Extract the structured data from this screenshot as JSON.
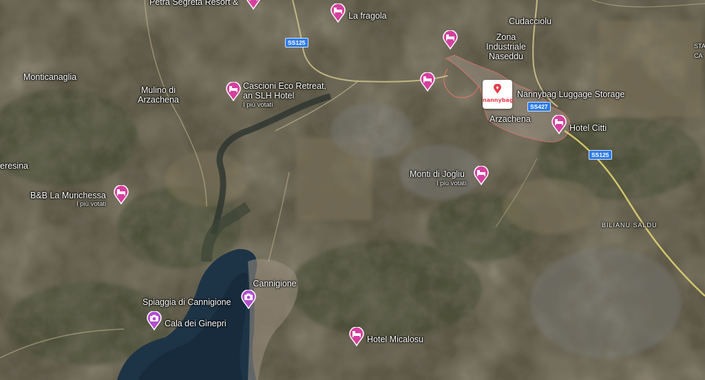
{
  "map": {
    "places": {
      "petra_segreta": "Petra Segreta Resort &",
      "la_fragola": "La fragola",
      "cudacciolu": "Cudacciolu",
      "zona_industriale": "Zona\nIndustriale\nNaseddu",
      "monticanaglia": "Monticanaglia",
      "mulino_di_arzachena": "Mulino di\nArzachena",
      "cascioni": "Cascioni Eco Retreat,\nan SLH Hotel",
      "cascioni_sub": "I più votati",
      "nannybag_storage": "Nannybag Luggage Storage",
      "arzachena": "Arzachena",
      "hotel_citti": "Hotel Citti",
      "eresina": "eresina",
      "monti_di_jogliu": "Monti di Jogliu",
      "monti_di_jogliu_sub": "I più votati",
      "bb_la_murichessa": "B&B La Murichessa",
      "bb_la_murichessa_sub": "I più votati",
      "bilianu_saldu": "BILIANU SALDU",
      "cannigione": "Cannigione",
      "spiaggia_di_cannigione": "Spiaggia di Cannigione",
      "cala_dei_ginepri": "Cala dei Ginepri",
      "hotel_micalosu": "Hotel Micalosu",
      "edge_top_right": "STA\nCA"
    },
    "roads": {
      "ss125_a": "SS125",
      "ss427": "SS427",
      "ss125_b": "SS125"
    },
    "brand_marker": "nannybag",
    "colors": {
      "hotel_pin": "#d5409e",
      "attraction_pin": "#b34dd0",
      "road_shield": "#2c7be5",
      "town_outline": "#e8736b",
      "brand_red": "#e63a4a"
    },
    "icons": {
      "hotel": "bed-icon",
      "attraction": "camera-icon"
    }
  }
}
